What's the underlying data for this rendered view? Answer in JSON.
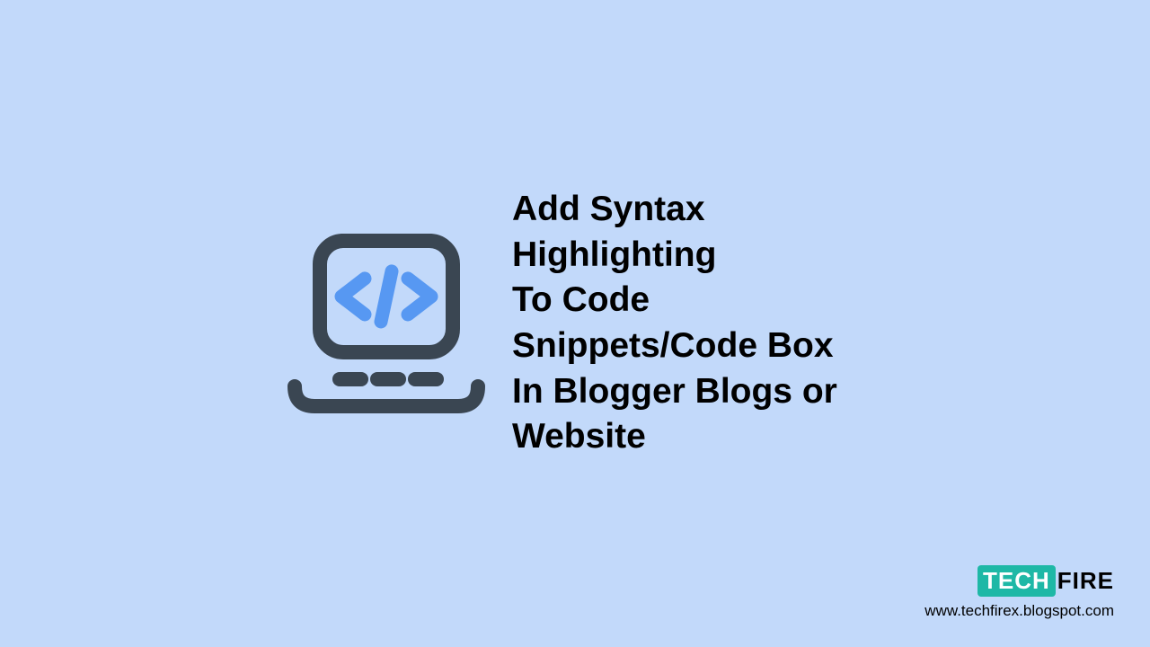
{
  "heading": {
    "line1": "Add Syntax Highlighting",
    "line2": "To Code Snippets/Code Box",
    "line3": "In Blogger Blogs or Website"
  },
  "branding": {
    "logo_part1": "TECH",
    "logo_part2": "FIRE",
    "url": "www.techfirex.blogspot.com"
  },
  "colors": {
    "background": "#c2d9fa",
    "icon_dark": "#3a4652",
    "icon_accent": "#5798f2",
    "logo_bg": "#1eb8a6"
  }
}
